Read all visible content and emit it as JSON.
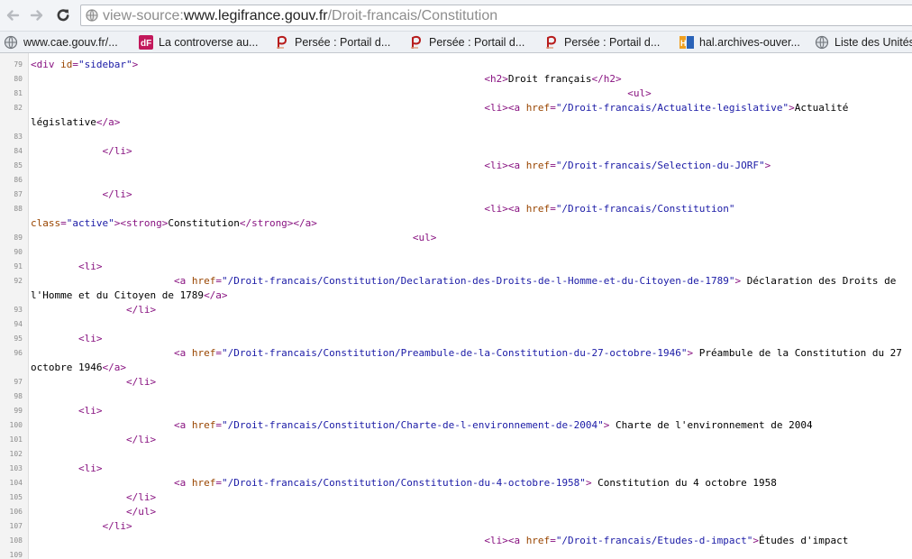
{
  "toolbar": {
    "back_icon": "back-arrow-icon",
    "forward_icon": "forward-arrow-icon",
    "reload_icon": "reload-icon",
    "url_prefix": "view-source:",
    "url_host": "www.legifrance.gouv.fr",
    "url_path": "/Droit-francais/Constitution"
  },
  "bookmarks": [
    {
      "label": "www.cae.gouv.fr/...",
      "icon": "globe-icon"
    },
    {
      "label": "La controverse au...",
      "icon": "df-favicon"
    },
    {
      "label": "Persée : Portail d...",
      "icon": "persee-favicon"
    },
    {
      "label": "Persée : Portail d...",
      "icon": "persee-favicon"
    },
    {
      "label": "Persée : Portail d...",
      "icon": "persee-favicon"
    },
    {
      "label": "hal.archives-ouver...",
      "icon": "hal-favicon"
    },
    {
      "label": "Liste des Unités",
      "icon": "globe-icon"
    }
  ],
  "colors": {
    "tag": "#881280",
    "attr_name": "#994500",
    "attr_value": "#1a1aa6",
    "line_number": "#8c8c8c"
  },
  "source": [
    {
      "n": "79",
      "parts": [
        [
          "tag",
          "<div "
        ],
        [
          "an",
          "id"
        ],
        [
          "tag",
          "="
        ],
        [
          "av",
          "\"sidebar\""
        ],
        [
          "tag",
          ">"
        ]
      ]
    },
    {
      "n": "80",
      "parts": [
        [
          "txt",
          "                                                                            "
        ],
        [
          "tag",
          "<h2>"
        ],
        [
          "txt",
          "Droit français"
        ],
        [
          "tag",
          "</h2>"
        ]
      ]
    },
    {
      "n": "81",
      "parts": [
        [
          "txt",
          "                                                                                                    "
        ],
        [
          "tag",
          "<ul>"
        ]
      ]
    },
    {
      "n": "82",
      "parts": [
        [
          "txt",
          "                                                                            "
        ],
        [
          "tag",
          "<li><a "
        ],
        [
          "an",
          "href"
        ],
        [
          "tag",
          "="
        ],
        [
          "av",
          "\"/Droit-francais/Actualite-legislative\""
        ],
        [
          "tag",
          ">"
        ],
        [
          "txt",
          "Actualité"
        ]
      ]
    },
    {
      "n": "",
      "parts": [
        [
          "txt",
          "législative"
        ],
        [
          "tag",
          "</a>"
        ]
      ]
    },
    {
      "n": "83",
      "parts": []
    },
    {
      "n": "84",
      "parts": [
        [
          "txt",
          "            "
        ],
        [
          "tag",
          "</li>"
        ]
      ]
    },
    {
      "n": "85",
      "parts": [
        [
          "txt",
          "                                                                            "
        ],
        [
          "tag",
          "<li><a "
        ],
        [
          "an",
          "href"
        ],
        [
          "tag",
          "="
        ],
        [
          "av",
          "\"/Droit-francais/Selection-du-JORF\""
        ],
        [
          "tag",
          ">"
        ]
      ]
    },
    {
      "n": "86",
      "parts": []
    },
    {
      "n": "87",
      "parts": [
        [
          "txt",
          "            "
        ],
        [
          "tag",
          "</li>"
        ]
      ]
    },
    {
      "n": "88",
      "parts": [
        [
          "txt",
          "                                                                            "
        ],
        [
          "tag",
          "<li><a "
        ],
        [
          "an",
          "href"
        ],
        [
          "tag",
          "="
        ],
        [
          "av",
          "\"/Droit-francais/Constitution\""
        ]
      ]
    },
    {
      "n": "",
      "parts": [
        [
          "an",
          "class"
        ],
        [
          "tag",
          "="
        ],
        [
          "av",
          "\"active\""
        ],
        [
          "tag",
          "><strong>"
        ],
        [
          "txt",
          "Constitution"
        ],
        [
          "tag",
          "</strong></a>"
        ]
      ]
    },
    {
      "n": "89",
      "parts": [
        [
          "txt",
          "                                                                "
        ],
        [
          "tag",
          "<ul>"
        ]
      ]
    },
    {
      "n": "90",
      "parts": []
    },
    {
      "n": "91",
      "parts": [
        [
          "txt",
          "        "
        ],
        [
          "tag",
          "<li>"
        ]
      ]
    },
    {
      "n": "92",
      "parts": [
        [
          "txt",
          "                        "
        ],
        [
          "tag",
          "<a "
        ],
        [
          "an",
          "href"
        ],
        [
          "tag",
          "="
        ],
        [
          "av",
          "\"/Droit-francais/Constitution/Declaration-des-Droits-de-l-Homme-et-du-Citoyen-de-1789\""
        ],
        [
          "tag",
          ">"
        ],
        [
          "txt",
          " Déclaration des Droits de"
        ]
      ]
    },
    {
      "n": "",
      "parts": [
        [
          "txt",
          "l'Homme et du Citoyen de 1789"
        ],
        [
          "tag",
          "</a>"
        ]
      ]
    },
    {
      "n": "93",
      "parts": [
        [
          "txt",
          "                "
        ],
        [
          "tag",
          "</li>"
        ]
      ]
    },
    {
      "n": "94",
      "parts": []
    },
    {
      "n": "95",
      "parts": [
        [
          "txt",
          "        "
        ],
        [
          "tag",
          "<li>"
        ]
      ]
    },
    {
      "n": "96",
      "parts": [
        [
          "txt",
          "                        "
        ],
        [
          "tag",
          "<a "
        ],
        [
          "an",
          "href"
        ],
        [
          "tag",
          "="
        ],
        [
          "av",
          "\"/Droit-francais/Constitution/Preambule-de-la-Constitution-du-27-octobre-1946\""
        ],
        [
          "tag",
          ">"
        ],
        [
          "txt",
          " Préambule de la Constitution du 27"
        ]
      ]
    },
    {
      "n": "",
      "parts": [
        [
          "txt",
          "octobre 1946"
        ],
        [
          "tag",
          "</a>"
        ]
      ]
    },
    {
      "n": "97",
      "parts": [
        [
          "txt",
          "                "
        ],
        [
          "tag",
          "</li>"
        ]
      ]
    },
    {
      "n": "98",
      "parts": []
    },
    {
      "n": "99",
      "parts": [
        [
          "txt",
          "        "
        ],
        [
          "tag",
          "<li>"
        ]
      ]
    },
    {
      "n": "100",
      "parts": [
        [
          "txt",
          "                        "
        ],
        [
          "tag",
          "<a "
        ],
        [
          "an",
          "href"
        ],
        [
          "tag",
          "="
        ],
        [
          "av",
          "\"/Droit-francais/Constitution/Charte-de-l-environnement-de-2004\""
        ],
        [
          "tag",
          ">"
        ],
        [
          "txt",
          " Charte de l'environnement de 2004"
        ]
      ]
    },
    {
      "n": "101",
      "parts": [
        [
          "txt",
          "                "
        ],
        [
          "tag",
          "</li>"
        ]
      ]
    },
    {
      "n": "102",
      "parts": []
    },
    {
      "n": "103",
      "parts": [
        [
          "txt",
          "        "
        ],
        [
          "tag",
          "<li>"
        ]
      ]
    },
    {
      "n": "104",
      "parts": [
        [
          "txt",
          "                        "
        ],
        [
          "tag",
          "<a "
        ],
        [
          "an",
          "href"
        ],
        [
          "tag",
          "="
        ],
        [
          "av",
          "\"/Droit-francais/Constitution/Constitution-du-4-octobre-1958\""
        ],
        [
          "tag",
          ">"
        ],
        [
          "txt",
          " Constitution du 4 octobre 1958"
        ]
      ]
    },
    {
      "n": "105",
      "parts": [
        [
          "txt",
          "                "
        ],
        [
          "tag",
          "</li>"
        ]
      ]
    },
    {
      "n": "106",
      "parts": [
        [
          "txt",
          "                "
        ],
        [
          "tag",
          "</ul>"
        ]
      ]
    },
    {
      "n": "107",
      "parts": [
        [
          "txt",
          "            "
        ],
        [
          "tag",
          "</li>"
        ]
      ]
    },
    {
      "n": "108",
      "parts": [
        [
          "txt",
          "                                                                            "
        ],
        [
          "tag",
          "<li><a "
        ],
        [
          "an",
          "href"
        ],
        [
          "tag",
          "="
        ],
        [
          "av",
          "\"/Droit-francais/Etudes-d-impact\""
        ],
        [
          "tag",
          ">"
        ],
        [
          "txt",
          "Études d'impact"
        ]
      ]
    },
    {
      "n": "109",
      "parts": []
    }
  ]
}
